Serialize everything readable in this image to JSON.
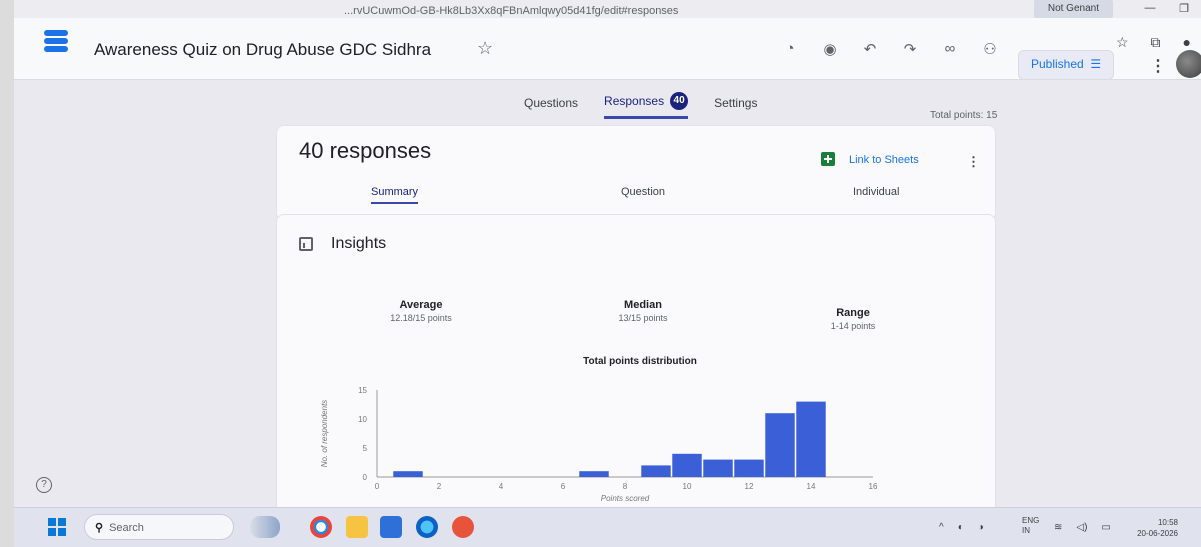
{
  "browser": {
    "url": "...rvUCuwmOd-GB-Hk8Lb3Xx8qFBnAmlqwy05d41fg/edit#responses",
    "account": "Not Genant"
  },
  "app": {
    "title": "Awareness Quiz on Drug Abuse GDC Sidhra",
    "published_label": "Published",
    "brand_color": "#1a73e8",
    "accent_color": "#1a237e"
  },
  "tabs": [
    {
      "label": "Questions",
      "active": false
    },
    {
      "label": "Responses",
      "active": true,
      "badge": "40"
    },
    {
      "label": "Settings",
      "active": false
    }
  ],
  "total_points": "Total points: 15",
  "summary": {
    "response_count": "40 responses",
    "link_to_sheets": "Link to Sheets",
    "subtabs": [
      "Summary",
      "Question",
      "Individual"
    ]
  },
  "insights": {
    "title": "Insights",
    "stats": [
      {
        "label": "Average",
        "value": "12.18/15 points"
      },
      {
        "label": "Median",
        "value": "13/15 points"
      },
      {
        "label": "Range",
        "value": "1-14 points"
      }
    ]
  },
  "chart_data": {
    "type": "bar",
    "title": "Total points distribution",
    "xlabel": "Points scored",
    "ylabel": "No. of respondents",
    "x_ticks": [
      0,
      2,
      4,
      6,
      8,
      10,
      12,
      14,
      16
    ],
    "y_ticks": [
      0,
      5,
      10,
      15
    ],
    "xlim": [
      0,
      16
    ],
    "ylim": [
      0,
      15
    ],
    "x": [
      1,
      7,
      9,
      10,
      11,
      12,
      13,
      14
    ],
    "values": [
      1,
      1,
      2,
      4,
      3,
      3,
      11,
      13
    ],
    "bar_color": "#3b5fd6",
    "grid": false
  },
  "taskbar": {
    "search_placeholder": "Search",
    "lang_line1": "ENG",
    "lang_line2": "IN",
    "time": "10:58",
    "date": "20-06-2026"
  }
}
